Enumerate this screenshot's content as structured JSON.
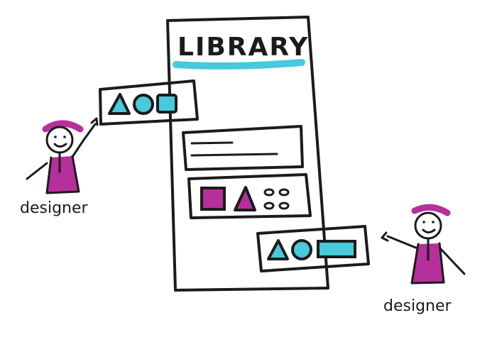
{
  "library": {
    "title": "LIBRARY"
  },
  "actors": {
    "left_label": "designer",
    "right_label": "designer"
  },
  "colors": {
    "ink": "#1b1b1b",
    "cyan": "#48c9dc",
    "magenta": "#b5309a",
    "paper": "#ffffff"
  },
  "icons": {
    "top_left_component": [
      "triangle-icon",
      "circle-icon",
      "square-icon"
    ],
    "library_card_2": [
      "square-icon",
      "triangle-icon",
      "oval-dots-icon"
    ],
    "bottom_right_component": [
      "triangle-icon",
      "circle-icon",
      "rectangle-icon"
    ]
  }
}
